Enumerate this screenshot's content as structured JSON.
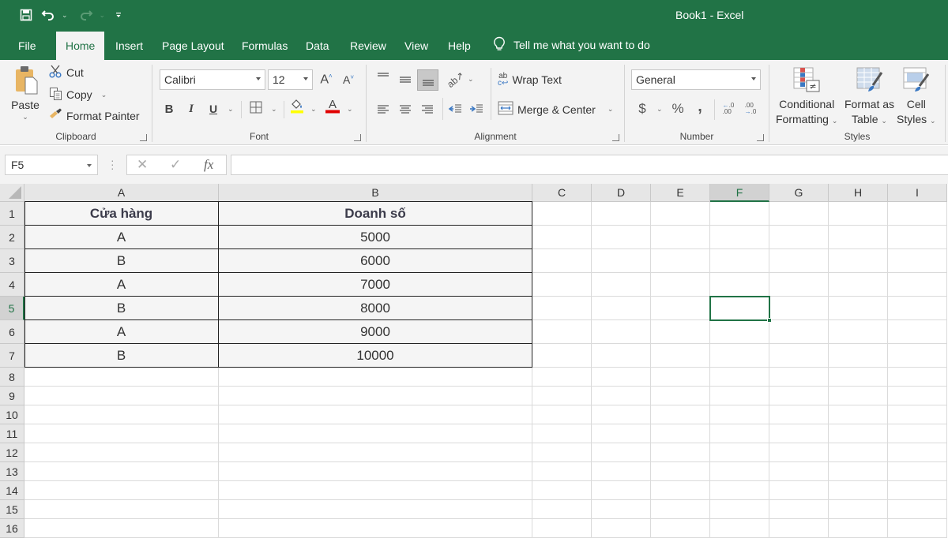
{
  "app": {
    "title": "Book1  -  Excel",
    "accent_color": "#217346"
  },
  "quick_access": {
    "icons": [
      "save-icon",
      "undo-icon",
      "redo-icon",
      "customize-qat-icon"
    ]
  },
  "tabs": [
    {
      "label": "File",
      "active": false
    },
    {
      "label": "Home",
      "active": true
    },
    {
      "label": "Insert",
      "active": false
    },
    {
      "label": "Page Layout",
      "active": false
    },
    {
      "label": "Formulas",
      "active": false
    },
    {
      "label": "Data",
      "active": false
    },
    {
      "label": "Review",
      "active": false
    },
    {
      "label": "View",
      "active": false
    },
    {
      "label": "Help",
      "active": false
    }
  ],
  "tell_me": "Tell me what you want to do",
  "ribbon": {
    "clipboard": {
      "label": "Clipboard",
      "paste": "Paste",
      "cut": "Cut",
      "copy": "Copy",
      "format_painter": "Format Painter"
    },
    "font": {
      "label": "Font",
      "font_name": "Calibri",
      "font_size": "12",
      "bold": "B",
      "italic": "I",
      "underline": "U",
      "fill_color": "#ffff00",
      "font_color": "#e00000"
    },
    "alignment": {
      "label": "Alignment",
      "wrap_text": "Wrap Text",
      "merge_center": "Merge & Center"
    },
    "number": {
      "label": "Number",
      "format": "General",
      "currency": "$",
      "percent": "%",
      "comma": ","
    },
    "styles": {
      "label": "Styles",
      "conditional_formatting": [
        "Conditional",
        "Formatting"
      ],
      "format_as_table": [
        "Format as",
        "Table"
      ],
      "cell_styles": [
        "Cell",
        "Styles"
      ]
    }
  },
  "formula_bar": {
    "name_box": "F5",
    "fx": "fx",
    "value": ""
  },
  "sheet": {
    "columns": [
      "A",
      "B",
      "C",
      "D",
      "E",
      "F",
      "G",
      "H",
      "I"
    ],
    "rows": [
      "1",
      "2",
      "3",
      "4",
      "5",
      "6",
      "7",
      "8",
      "9",
      "10",
      "11",
      "12",
      "13",
      "14",
      "15",
      "16"
    ],
    "selected_cell": "F5",
    "table": {
      "headers": [
        "Cửa hàng",
        "Doanh số"
      ],
      "rows": [
        [
          "A",
          "5000"
        ],
        [
          "B",
          "6000"
        ],
        [
          "A",
          "7000"
        ],
        [
          "B",
          "8000"
        ],
        [
          "A",
          "9000"
        ],
        [
          "B",
          "10000"
        ]
      ]
    }
  }
}
